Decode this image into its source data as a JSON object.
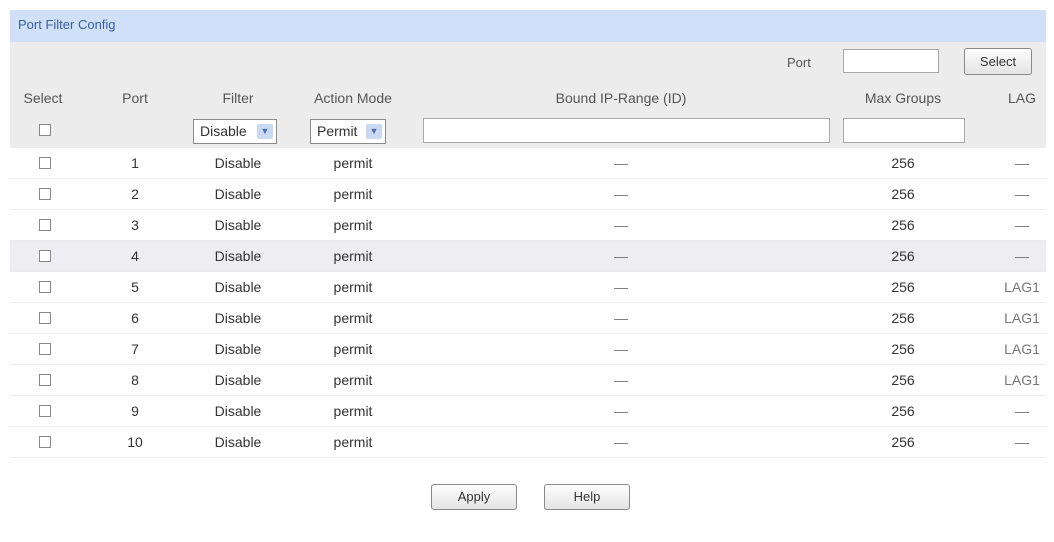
{
  "panel": {
    "title": "Port Filter Config"
  },
  "search": {
    "port_label": "Port",
    "port_value": "",
    "select_label": "Select"
  },
  "columns": {
    "select": "Select",
    "port": "Port",
    "filter": "Filter",
    "action_mode": "Action Mode",
    "bound_ip_range": "Bound IP-Range (ID)",
    "max_groups": "Max Groups",
    "lag": "LAG"
  },
  "batch": {
    "filter": "Disable",
    "action_mode": "Permit",
    "bound_ip_range": "",
    "max_groups": ""
  },
  "rows": [
    {
      "port": "1",
      "filter": "Disable",
      "action_mode": "permit",
      "bound_ip_range": "—",
      "max_groups": "256",
      "lag": "—"
    },
    {
      "port": "2",
      "filter": "Disable",
      "action_mode": "permit",
      "bound_ip_range": "—",
      "max_groups": "256",
      "lag": "—"
    },
    {
      "port": "3",
      "filter": "Disable",
      "action_mode": "permit",
      "bound_ip_range": "—",
      "max_groups": "256",
      "lag": "—"
    },
    {
      "port": "4",
      "filter": "Disable",
      "action_mode": "permit",
      "bound_ip_range": "—",
      "max_groups": "256",
      "lag": "—"
    },
    {
      "port": "5",
      "filter": "Disable",
      "action_mode": "permit",
      "bound_ip_range": "—",
      "max_groups": "256",
      "lag": "LAG1"
    },
    {
      "port": "6",
      "filter": "Disable",
      "action_mode": "permit",
      "bound_ip_range": "—",
      "max_groups": "256",
      "lag": "LAG1"
    },
    {
      "port": "7",
      "filter": "Disable",
      "action_mode": "permit",
      "bound_ip_range": "—",
      "max_groups": "256",
      "lag": "LAG1"
    },
    {
      "port": "8",
      "filter": "Disable",
      "action_mode": "permit",
      "bound_ip_range": "—",
      "max_groups": "256",
      "lag": "LAG1"
    },
    {
      "port": "9",
      "filter": "Disable",
      "action_mode": "permit",
      "bound_ip_range": "—",
      "max_groups": "256",
      "lag": "—"
    },
    {
      "port": "10",
      "filter": "Disable",
      "action_mode": "permit",
      "bound_ip_range": "—",
      "max_groups": "256",
      "lag": "—"
    }
  ],
  "buttons": {
    "apply": "Apply",
    "help": "Help"
  },
  "colors": {
    "header_bg": "#cfe0f8",
    "header_text": "#3a5f9e",
    "table_head_bg": "#ececec",
    "highlight_row": "#ededf2"
  }
}
